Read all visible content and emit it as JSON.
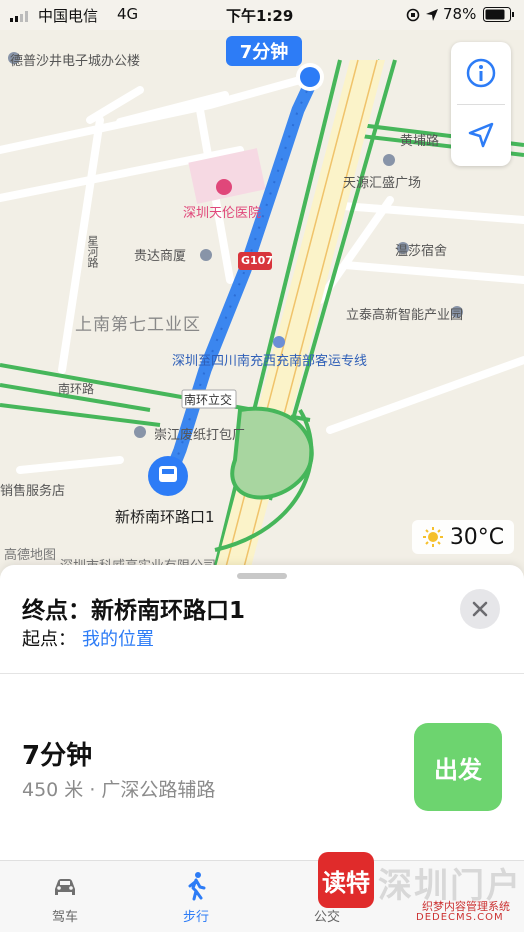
{
  "status": {
    "carrier": "中国电信",
    "network": "4G",
    "time": "下午1:29",
    "battery": "78%"
  },
  "map": {
    "eta_bubble": "7分钟",
    "labels": {
      "deshapu": "德普沙井电子城办公楼",
      "huangpu_road": "黄埔路",
      "tianyuan": "天源汇盛广场",
      "tianlun_hospital": "深圳天伦医院",
      "guida": "贵达商厦",
      "wensha": "温莎宿舍",
      "xinghe_road": "星河路",
      "highway": "G107",
      "lunan_seven": "上南第七工业区",
      "litai": "立泰高新智能产业园",
      "bus_line": "深圳至四川南充西充南部客运专线",
      "nanhuan_road": "南环路",
      "nanhuan_interchange": "南环立交",
      "chongjiang": "崇江废纸打包厂",
      "sales_service": "销售服务店",
      "destination_stop": "新桥南环路口1",
      "gaode": "高德地图",
      "kewei": "深圳市科威高实业有限公司"
    },
    "weather": "30°C"
  },
  "sheet": {
    "dest_label": "终点：",
    "dest_value": "新桥南环路口1",
    "origin_label": "起点：",
    "origin_value": "我的位置",
    "route_time": "7分钟",
    "route_desc": "450 米 · 广深公路辅路",
    "go_label": "出发"
  },
  "tabs": [
    {
      "label": "驾车",
      "icon": "car-icon"
    },
    {
      "label": "步行",
      "icon": "walk-icon"
    },
    {
      "label": "公交",
      "icon": "bus-icon"
    }
  ],
  "watermark": {
    "logo": "读特",
    "name": "深圳门户",
    "sub1": "织梦内容管理系统",
    "sub2": "DEDECMS.COM"
  },
  "colors": {
    "accent": "#2d7cf6",
    "go": "#6dd46f",
    "route": "#3b86ef",
    "road_green": "#46b65a"
  }
}
